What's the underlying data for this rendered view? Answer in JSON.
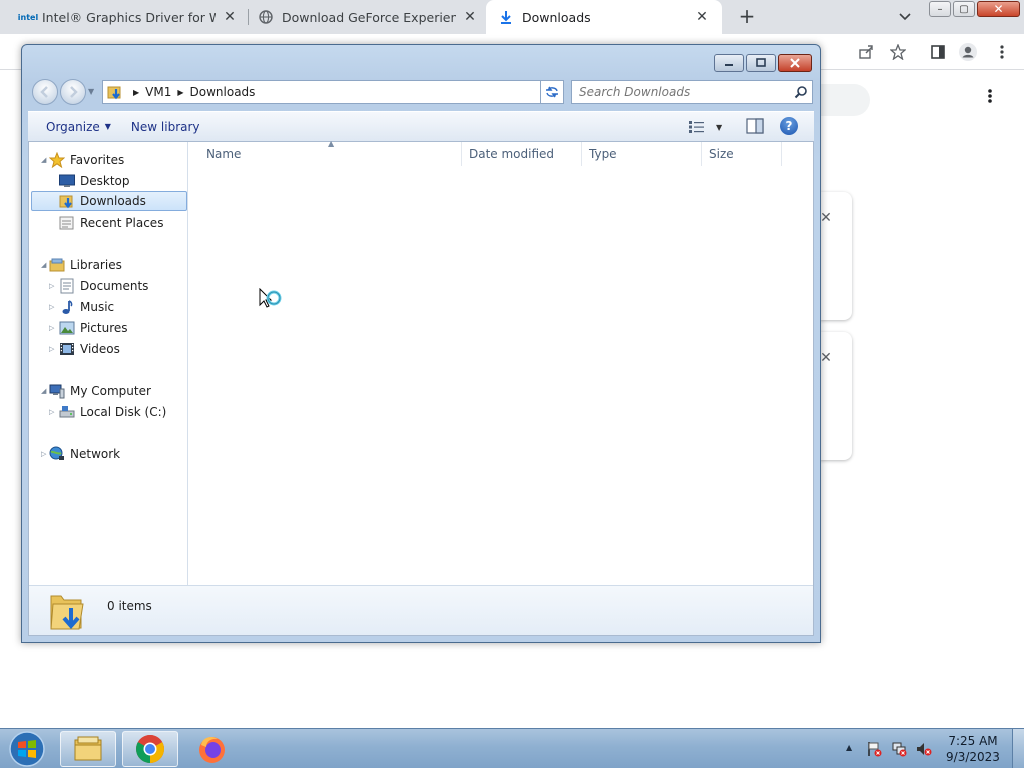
{
  "browser": {
    "tabs": [
      {
        "label": "Intel® Graphics Driver for Windc",
        "favicon": "intel-logo",
        "logo_text": "intel"
      },
      {
        "label": "Download GeForce Experience | I",
        "favicon": "globe-icon"
      },
      {
        "label": "Downloads",
        "favicon": "download-icon",
        "active": true
      }
    ],
    "new_tab_label": "+",
    "window_controls": {
      "minimize": "–",
      "maximize": "▢",
      "close": "✕"
    }
  },
  "explorer": {
    "breadcrumb": [
      "VM1",
      "Downloads"
    ],
    "search_placeholder": "Search Downloads",
    "toolbar": {
      "organize": "Organize",
      "new_library": "New library",
      "help": "?"
    },
    "nav": {
      "favorites": {
        "label": "Favorites",
        "items": [
          "Desktop",
          "Downloads",
          "Recent Places"
        ],
        "selected": "Downloads"
      },
      "libraries": {
        "label": "Libraries",
        "items": [
          "Documents",
          "Music",
          "Pictures",
          "Videos"
        ]
      },
      "computer": {
        "label": "My Computer",
        "items": [
          "Local Disk (C:)"
        ]
      },
      "network": {
        "label": "Network"
      }
    },
    "columns": [
      "Name",
      "Date modified",
      "Type",
      "Size"
    ],
    "items": [],
    "status": "0 items"
  },
  "taskbar": {
    "apps": [
      "windows-explorer",
      "google-chrome",
      "firefox"
    ],
    "clock": {
      "time": "7:25 AM",
      "date": "9/3/2023"
    }
  },
  "colors": {
    "selection": "#cce3fa",
    "window_frame": "#b9cfe8",
    "taskbar": "#8fb0d1",
    "link_text": "#1e3287"
  }
}
